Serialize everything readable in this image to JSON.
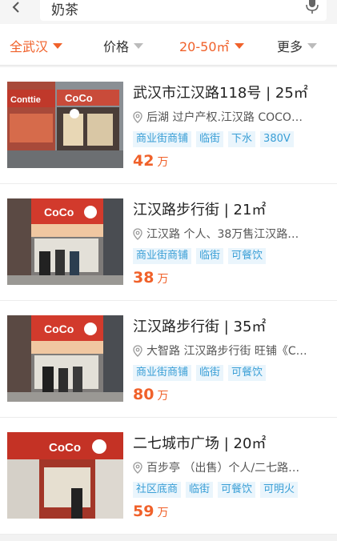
{
  "search": {
    "query": "奶茶"
  },
  "filters": [
    {
      "label": "全武汉",
      "active": true
    },
    {
      "label": "价格",
      "active": false
    },
    {
      "label": "20-50㎡",
      "active": true
    },
    {
      "label": "更多",
      "active": false
    }
  ],
  "listings": [
    {
      "title": "武汉市江汉路118号 | 25㎡",
      "location": "后湖  过户产权.江汉路 COCO…",
      "tags": [
        "商业街商铺",
        "临街",
        "下水",
        "380V"
      ],
      "price": "42",
      "unit": "万",
      "store_sign": "CoCo",
      "left_sign": "Conttie"
    },
    {
      "title": "江汉路步行街 | 21㎡",
      "location": "江汉路  个人、38万售江汉路…",
      "tags": [
        "商业街商铺",
        "临街",
        "可餐饮"
      ],
      "price": "38",
      "unit": "万",
      "store_sign": "CoCo"
    },
    {
      "title": "江汉路步行街 | 35㎡",
      "location": "大智路  江汉路步行街 旺铺《C…",
      "tags": [
        "商业街商铺",
        "临街",
        "可餐饮"
      ],
      "price": "80",
      "unit": "万",
      "store_sign": "CoCo"
    },
    {
      "title": "二七城市广场 | 20㎡",
      "location": "百步亭  （出售）个人/二七路…",
      "tags": [
        "社区底商",
        "临街",
        "可餐饮",
        "可明火"
      ],
      "price": "59",
      "unit": "万",
      "store_sign": "CoCo"
    }
  ]
}
